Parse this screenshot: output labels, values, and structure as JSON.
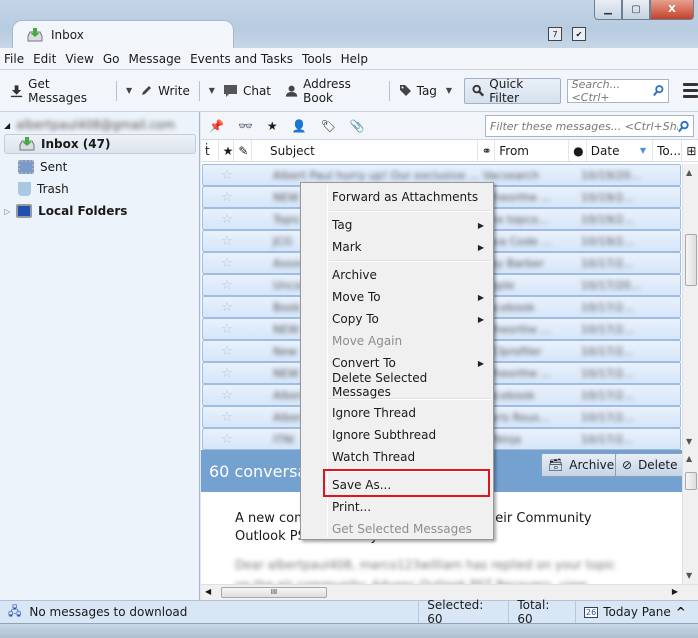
{
  "window": {
    "tab_title": "Inbox",
    "controls": {
      "minimize": "—",
      "maximize": "□",
      "close": "X"
    },
    "top_icons": [
      "calendar-icon",
      "tasks-icon"
    ],
    "calendar_day": "7"
  },
  "menubar": {
    "items": [
      {
        "label": "File",
        "accel": "F"
      },
      {
        "label": "Edit",
        "accel": "E"
      },
      {
        "label": "View",
        "accel": "V"
      },
      {
        "label": "Go",
        "accel": "G"
      },
      {
        "label": "Message",
        "accel": "M"
      },
      {
        "label": "Events and Tasks",
        "accel": "n"
      },
      {
        "label": "Tools",
        "accel": "T"
      },
      {
        "label": "Help",
        "accel": "H"
      }
    ]
  },
  "toolbar": {
    "get_messages": "Get Messages",
    "write": "Write",
    "chat": "Chat",
    "address_book": "Address Book",
    "tag": "Tag",
    "quick_filter": "Quick Filter",
    "search_placeholder": "Search... <Ctrl+"
  },
  "sidebar": {
    "account": "albertpaul408@gmail.com",
    "folders": [
      {
        "name": "Inbox (47)",
        "selected": true
      },
      {
        "name": "Sent"
      },
      {
        "name": "Trash"
      }
    ],
    "local_folders": "Local Folders"
  },
  "message_list": {
    "filter_placeholder": "Filter these messages... <Ctrl+Shift-",
    "columns": {
      "subject": "Subject",
      "from": "From",
      "date": "Date",
      "to": "To..."
    },
    "rows": [
      {
        "subject": "Albert Paul hurry up! Our exclusive ...",
        "from": "Vacsearch",
        "date": "10/19/20..."
      },
      {
        "subject": "NEW",
        "from": "Wheorthe ...",
        "date": "10/19/2..."
      },
      {
        "subject": "Topic",
        "from": "The topco...",
        "date": "10/19/2..."
      },
      {
        "subject": "JCG",
        "from": "Java Code ...",
        "date": "10/19/2..."
      },
      {
        "subject": "Assoc",
        "from": "Kay Barber",
        "date": "10/17/2..."
      },
      {
        "subject": "Uncon",
        "from": "Apple",
        "date": "10/17/20..."
      },
      {
        "subject": "Book",
        "from": "Facebook",
        "date": "10/17/2..."
      },
      {
        "subject": "NEW",
        "from": "Wheorthe ...",
        "date": "10/17/2..."
      },
      {
        "subject": "New",
        "from": "DCIprofiler",
        "date": "10/17/2..."
      },
      {
        "subject": "NEW",
        "from": "Wheorthe ...",
        "date": "10/17/2..."
      },
      {
        "subject": "Albert",
        "from": "Facebook",
        "date": "10/17/2..."
      },
      {
        "subject": "Albert",
        "from": "Paris Rous...",
        "date": "10/17/2..."
      },
      {
        "subject": "ITNi",
        "from": "ITNinja",
        "date": "10/17/2..."
      }
    ]
  },
  "summary": {
    "title": "60 conversations",
    "archive": "Archive",
    "delete": "Delete"
  },
  "preview": {
    "line1": "A new comment was posted on Advanc  eir Community",
    "line2": "Outlook PST Recovery",
    "blurred1": "Dear albertpaul408, marco123william has replied on your topic",
    "blurred2": "on the eir community: Advanc Outlook PST Recovery, view"
  },
  "context_menu": {
    "items": [
      {
        "label": "Forward as Attachments",
        "submenu": false,
        "disabled": false
      },
      {
        "label": "Tag",
        "submenu": true,
        "disabled": false
      },
      {
        "label": "Mark",
        "submenu": true,
        "disabled": false
      },
      {
        "label": "Archive",
        "submenu": false,
        "disabled": false
      },
      {
        "label": "Move To",
        "submenu": true,
        "disabled": false
      },
      {
        "label": "Copy To",
        "submenu": true,
        "disabled": false
      },
      {
        "label": "Move Again",
        "submenu": false,
        "disabled": true
      },
      {
        "label": "Convert To",
        "submenu": true,
        "disabled": false
      },
      {
        "label": "Delete Selected Messages",
        "submenu": false,
        "disabled": false
      },
      {
        "label": "Ignore Thread",
        "submenu": false,
        "disabled": false
      },
      {
        "label": "Ignore Subthread",
        "submenu": false,
        "disabled": false
      },
      {
        "label": "Watch Thread",
        "submenu": false,
        "disabled": false
      },
      {
        "label": "Save As...",
        "submenu": false,
        "disabled": false,
        "highlighted": true
      },
      {
        "label": "Print...",
        "submenu": false,
        "disabled": false
      },
      {
        "label": "Get Selected Messages",
        "submenu": false,
        "disabled": true
      }
    ],
    "highlight_color": "#e0141b"
  },
  "statusbar": {
    "message": "No messages to download",
    "selected": "Selected: 60",
    "total": "Total: 60",
    "today_pane": "Today Pane",
    "today_day": "26"
  }
}
